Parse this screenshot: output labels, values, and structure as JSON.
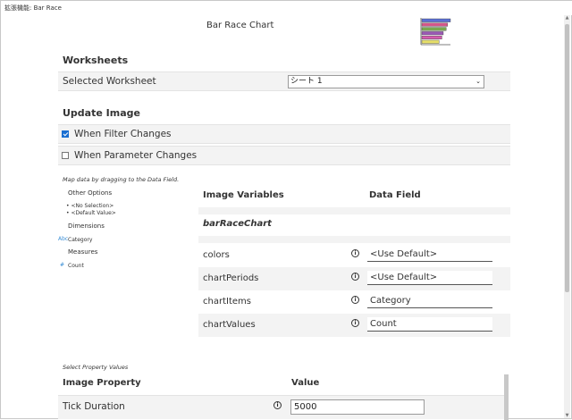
{
  "window": {
    "title": "拡張機能: Bar Race"
  },
  "app": {
    "title": "Bar Race Chart"
  },
  "logo_bars": {
    "colors": [
      "#5b6fd6",
      "#d4568a",
      "#7aa84f",
      "#9b59b6",
      "#d65bb0",
      "#e8e06a"
    ],
    "fractions": [
      1.0,
      0.9,
      0.85,
      0.75,
      0.7,
      0.6
    ]
  },
  "worksheets": {
    "section_title": "Worksheets",
    "selected_label": "Selected Worksheet",
    "selected_value": "シート 1"
  },
  "update_image": {
    "section_title": "Update Image",
    "filter_label": "When Filter Changes",
    "filter_checked": true,
    "parameter_label": "When Parameter Changes",
    "parameter_checked": false
  },
  "mapping": {
    "hint": "Map data by dragging to the Data Field.",
    "other_options_title": "Other Options",
    "other_options": [
      "<No Selection>",
      "<Default Value>"
    ],
    "dimensions_title": "Dimensions",
    "dimensions": [
      "Category"
    ],
    "measures_title": "Measures",
    "measures": [
      "Count"
    ]
  },
  "variables": {
    "col_variable": "Image Variables",
    "col_field": "Data Field",
    "group": "barRaceChart",
    "rows": [
      {
        "name": "colors",
        "value": "<Use Default>"
      },
      {
        "name": "chartPeriods",
        "value": "<Use Default>"
      },
      {
        "name": "chartItems",
        "value": "Category"
      },
      {
        "name": "chartValues",
        "value": "Count"
      }
    ]
  },
  "properties": {
    "hint": "Select Property Values",
    "col_property": "Image Property",
    "col_value": "Value",
    "rows": [
      {
        "name": "Tick Duration",
        "value": "5000"
      }
    ]
  }
}
